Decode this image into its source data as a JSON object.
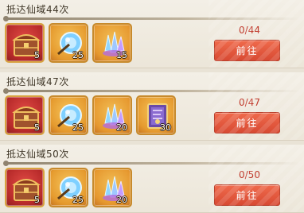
{
  "tasks": [
    {
      "title": "抵达仙域44次",
      "progress": "0/44",
      "button_label": "前往",
      "rewards": [
        {
          "icon": "treasure-chest-icon",
          "count": "5"
        },
        {
          "icon": "blue-orb-icon",
          "count": "25"
        },
        {
          "icon": "crystal-cluster-icon",
          "count": "15"
        }
      ]
    },
    {
      "title": "抵达仙域47次",
      "progress": "0/47",
      "button_label": "前往",
      "rewards": [
        {
          "icon": "treasure-chest-icon",
          "count": "5"
        },
        {
          "icon": "blue-orb-icon",
          "count": "25"
        },
        {
          "icon": "crystal-cluster-icon",
          "count": "20"
        },
        {
          "icon": "scroll-card-icon",
          "count": "30"
        }
      ]
    },
    {
      "title": "抵达仙域50次",
      "progress": "0/50",
      "button_label": "前往",
      "rewards": [
        {
          "icon": "treasure-chest-icon",
          "count": "5"
        },
        {
          "icon": "blue-orb-icon",
          "count": "25"
        },
        {
          "icon": "crystal-cluster-icon",
          "count": "20"
        }
      ]
    }
  ]
}
